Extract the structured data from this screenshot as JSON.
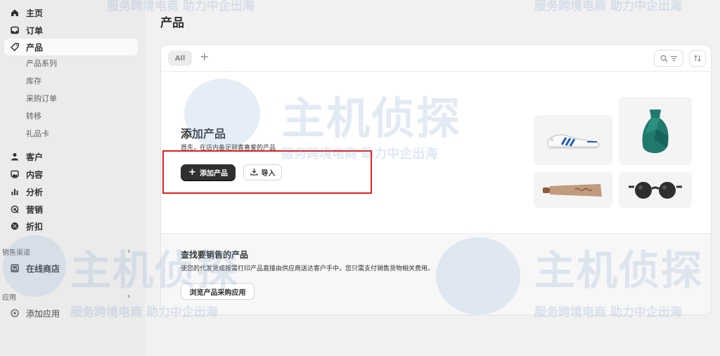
{
  "sidebar": {
    "items": [
      {
        "label": "主页",
        "icon": "home-icon"
      },
      {
        "label": "订单",
        "icon": "inbox-icon"
      },
      {
        "label": "产品",
        "icon": "tag-icon",
        "active": true
      },
      {
        "label": "客户",
        "icon": "person-icon"
      },
      {
        "label": "内容",
        "icon": "image-icon"
      },
      {
        "label": "分析",
        "icon": "bar-chart-icon"
      },
      {
        "label": "营销",
        "icon": "target-icon"
      },
      {
        "label": "折扣",
        "icon": "discount-icon"
      }
    ],
    "product_subitems": [
      "产品系列",
      "库存",
      "采购订单",
      "转移",
      "礼品卡"
    ],
    "sales_channels_label": "销售渠道",
    "online_store_label": "在线商店",
    "apps_label": "应用",
    "add_app_label": "添加应用"
  },
  "main": {
    "page_title": "产品",
    "tabs": {
      "all_label": "All"
    },
    "hero": {
      "title": "添加产品",
      "description": "首先，在店内备足顾客喜爱的产品",
      "add_button": "添加产品",
      "import_button": "导入"
    },
    "find": {
      "title": "查找要销售的产品",
      "description": "使您的代发货或按需打印产品直接由供应商送达客户手中，您只需支付销售货物相关费用。",
      "browse_button": "浏览产品采购应用"
    }
  },
  "watermark": {
    "brand": "主机侦探",
    "slogan": "服务跨境电商 助力中企出海"
  },
  "colors": {
    "highlight": "#e02020",
    "primary_button": "#303030",
    "vase": "#1f7a6d"
  }
}
